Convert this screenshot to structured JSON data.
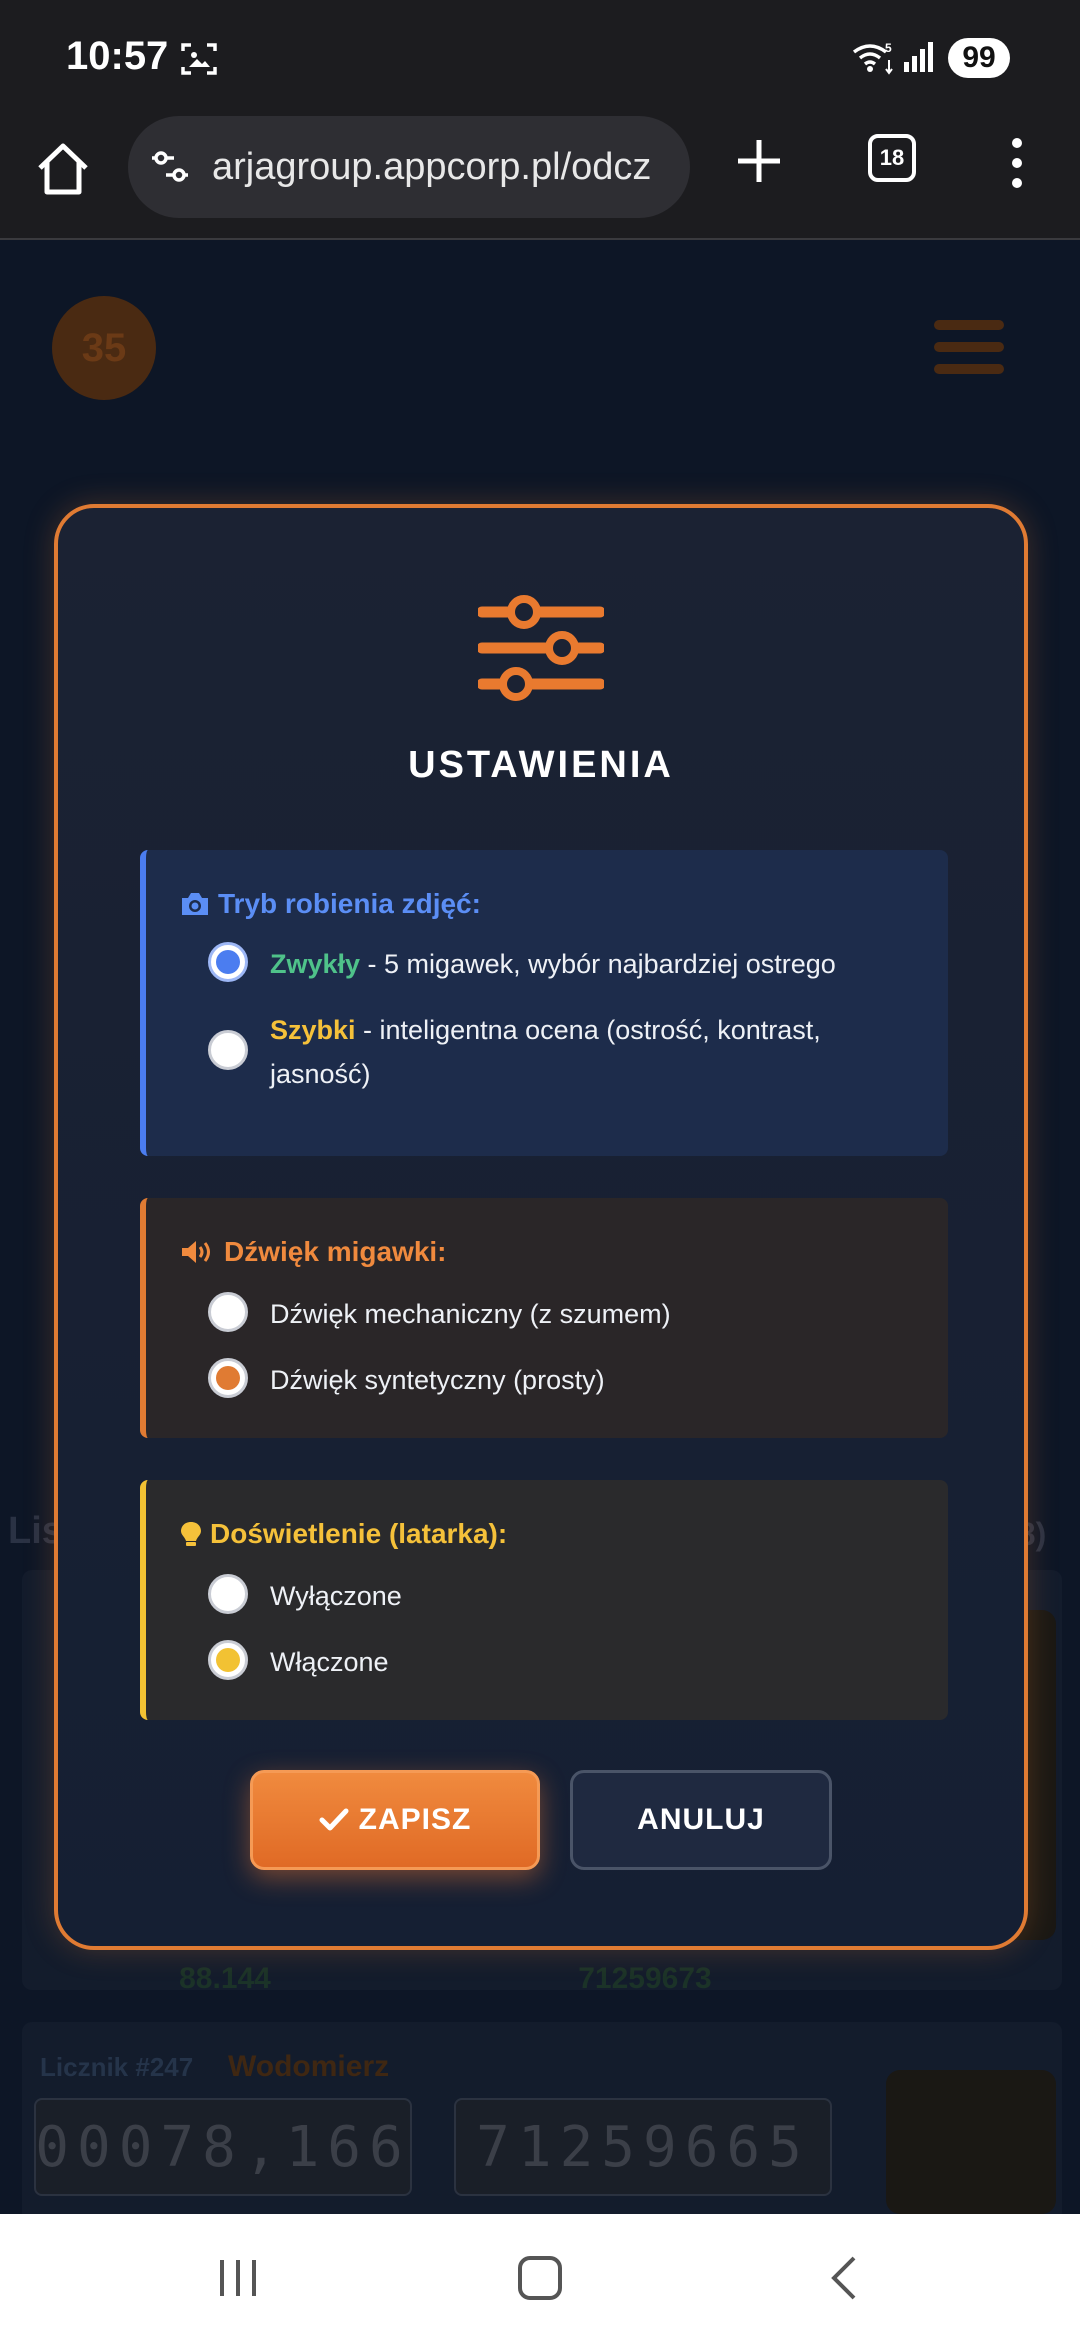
{
  "status_bar": {
    "time": "10:57",
    "battery": "99",
    "wifi_label": "5"
  },
  "browser": {
    "url": "arjagroup.appcorp.pl/odcz",
    "tab_count": "18"
  },
  "background_page": {
    "badge_count": "35",
    "list_title": "Lis",
    "list_count": "38)",
    "cards": [
      {
        "tag": "Licznik #247",
        "type": "Wodomierz",
        "reading": "78.166",
        "serial": "71259665",
        "display_left": "00078,166",
        "display_right": "71259665"
      },
      {
        "reading": "88.144",
        "serial": "71259673"
      }
    ]
  },
  "modal": {
    "title": "USTAWIENIA",
    "sections": {
      "photo": {
        "heading": "Tryb robienia zdjęć:",
        "options": [
          {
            "keyword": "Zwykły",
            "description": " - 5 migawek, wybór najbardziej ostrego",
            "selected": true
          },
          {
            "keyword": "Szybki",
            "description": " - inteligentna ocena (ostrość, kontrast, jasność)",
            "selected": false
          }
        ]
      },
      "sound": {
        "heading": "Dźwięk migawki:",
        "options": [
          {
            "label": "Dźwięk mechaniczny (z szumem)",
            "selected": false
          },
          {
            "label": "Dźwięk syntetyczny (prosty)",
            "selected": true
          }
        ]
      },
      "light": {
        "heading": "Doświetlenie (latarka):",
        "options": [
          {
            "label": "Wyłączone",
            "selected": false
          },
          {
            "label": "Włączone",
            "selected": true
          }
        ]
      }
    },
    "save_label": "ZAPISZ",
    "cancel_label": "ANULUJ"
  },
  "colors": {
    "accent_orange": "#e07b33",
    "accent_blue": "#4b7df0",
    "accent_yellow": "#f2c233",
    "accent_green": "#4fc28a"
  }
}
